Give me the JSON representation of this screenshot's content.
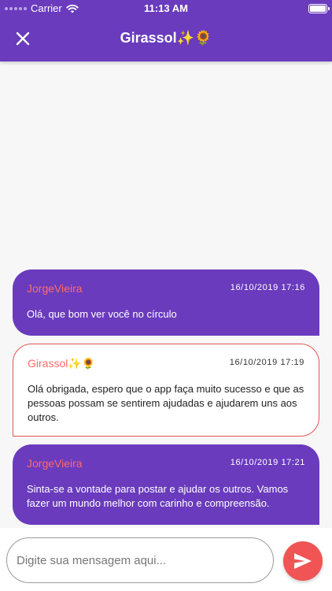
{
  "status_bar": {
    "carrier": "Carrier",
    "time": "11:13 AM"
  },
  "header": {
    "title": "Girassol✨🌻"
  },
  "messages": [
    {
      "sender": "JorgeVieira",
      "timestamp": "16/10/2019 17:16",
      "text": "Olá, que bom ver você no círculo",
      "is_mine": false
    },
    {
      "sender": "Girassol✨🌻",
      "timestamp": "16/10/2019 17:19",
      "text": "Olá obrigada, espero que o app faça muito sucesso e que as pessoas possam se sentirem ajudadas e ajudarem uns aos outros.",
      "is_mine": true
    },
    {
      "sender": "JorgeVieira",
      "timestamp": "16/10/2019 17:21",
      "text": "Sinta-se a vontade para postar e ajudar os outros. Vamos fazer um mundo melhor com carinho e compreensão.",
      "is_mine": false
    }
  ],
  "composer": {
    "placeholder": "Digite sua mensagem aqui..."
  },
  "colors": {
    "primary": "#6a3bbd",
    "accent": "#f05454",
    "sender_name": "#ff6b6b",
    "background": "#f7f7f7"
  },
  "icons": {
    "close": "close-icon",
    "send": "send-icon",
    "wifi": "wifi-icon",
    "battery": "battery-icon"
  }
}
